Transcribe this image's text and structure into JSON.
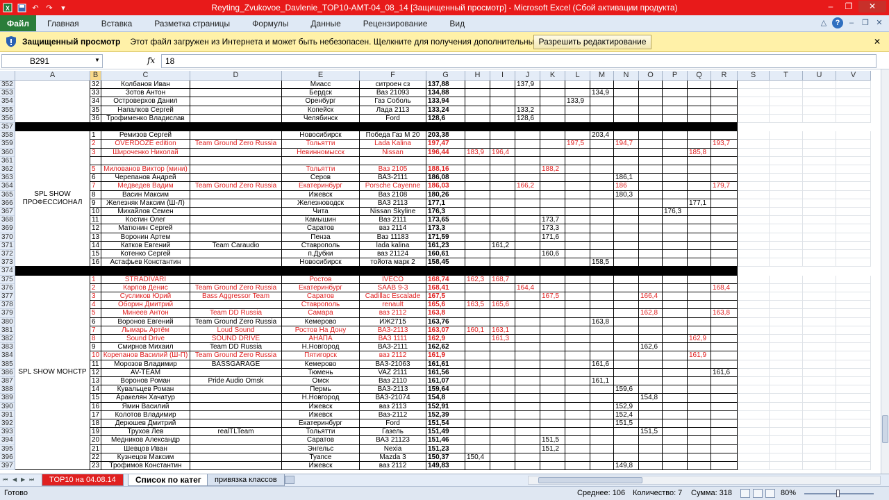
{
  "window": {
    "title": "Reyting_Zvukovoe_Davlenie_TOP10-AMT-04_08_14  [Защищенный просмотр]  -  Microsoft Excel (Сбой активации продукта)"
  },
  "ribbon": {
    "file_tab": "Файл",
    "tabs": [
      "Главная",
      "Вставка",
      "Разметка страницы",
      "Формулы",
      "Данные",
      "Рецензирование",
      "Вид"
    ]
  },
  "protected_view": {
    "title": "Защищенный просмотр",
    "message": "Этот файл загружен из Интернета и может быть небезопасен. Щелкните для получения дополнительных сведений.",
    "button": "Разрешить редактирование"
  },
  "formula_bar": {
    "name_box": "B291",
    "fx": "fx",
    "value": "18"
  },
  "columns": [
    "A",
    "B",
    "C",
    "D",
    "E",
    "F",
    "G",
    "H",
    "I",
    "J",
    "K",
    "L",
    "M",
    "N",
    "O",
    "P",
    "Q",
    "R",
    "S",
    "T",
    "U",
    "V"
  ],
  "sheet": {
    "group_labels": {
      "top": "",
      "professional": "SPL SHOW ПРОФЕССИОНАЛ",
      "monster": "SPL SHOW МОНСТР"
    },
    "rows": [
      {
        "n": "352",
        "b": "32",
        "c": "Колбанов Иван",
        "d": "",
        "e": "Миасс",
        "f": "ситроен сз",
        "g": "137,88",
        "vals": {
          "J": "137,9"
        }
      },
      {
        "n": "353",
        "b": "33",
        "c": "Зотов Антон",
        "d": "",
        "e": "Бердск",
        "f": "Ваз 21093",
        "g": "134,88",
        "vals": {
          "M": "134,9"
        }
      },
      {
        "n": "354",
        "b": "34",
        "c": "Островерхов Данил",
        "d": "",
        "e": "Оренбург",
        "f": "Газ Соболь",
        "g": "133,94",
        "vals": {
          "L": "133,9"
        }
      },
      {
        "n": "355",
        "b": "35",
        "c": "Напалков Сергей",
        "d": "",
        "e": "Копейск",
        "f": "Лада 2113",
        "g": "133,24",
        "vals": {
          "J": "133,2"
        }
      },
      {
        "n": "356",
        "b": "36",
        "c": "Трофименко Владислав",
        "d": "",
        "e": "Челябинск",
        "f": "Ford",
        "g": "128,6",
        "vals": {
          "J": "128,6"
        }
      },
      {
        "n": "357",
        "black": true
      },
      {
        "n": "358",
        "b": "1",
        "c": "Ремизов Сергей",
        "d": "",
        "e": "Новосибирск",
        "f": "Победа Газ М 20",
        "g": "203,38",
        "vals": {
          "M": "203,4"
        }
      },
      {
        "n": "359",
        "b": "2",
        "c": "OVERDOZE edition",
        "d": "Team Ground Zero Russia",
        "e": "Тольятти",
        "f": "Lada Kalina",
        "g": "197,47",
        "red": true,
        "vals": {
          "L": "197,5",
          "N": "194,7",
          "R": "193,7"
        }
      },
      {
        "n": "360",
        "b": "3",
        "c": "Широченко Николай",
        "d": "",
        "e": "Невинномысск",
        "f": "Nissan",
        "g": "196,44",
        "red": true,
        "vals": {
          "H": "183,9",
          "I": "196,4",
          "Q": "185,8"
        }
      },
      {
        "n": "361",
        "b": "",
        "c": "",
        "d": "",
        "e": "",
        "f": "",
        "g": "",
        "vals": {}
      },
      {
        "n": "362",
        "b": "5",
        "c": "Милованов Виктор (мини)",
        "d": "",
        "e": "Тольятти",
        "f": "Ваз 2105",
        "g": "188,16",
        "red": true,
        "vals": {
          "K": "188,2"
        }
      },
      {
        "n": "363",
        "b": "6",
        "c": "Черепанов Андрей",
        "d": "",
        "e": "Серов",
        "f": "ВАЗ-2111",
        "g": "186,08",
        "vals": {
          "N": "186,1"
        }
      },
      {
        "n": "364",
        "b": "7",
        "c": "Медведев Вадим",
        "d": "Team Ground Zero Russia",
        "e": "Екатеринбург",
        "f": "Porsche Cayenne",
        "g": "186,03",
        "red": true,
        "vals": {
          "J": "166,2",
          "N": "186",
          "R": "179,7"
        }
      },
      {
        "n": "365",
        "b": "8",
        "c": "Васин Максим",
        "d": "",
        "e": "Ижевск",
        "f": "Ваз 2108",
        "g": "180,26",
        "vals": {
          "N": "180,3"
        }
      },
      {
        "n": "366",
        "b": "9",
        "c": "Железняк Максим (Ш-Л)",
        "d": "",
        "e": "Железноводск",
        "f": "ВАЗ 2113",
        "g": "177,1",
        "vals": {
          "Q": "177,1"
        }
      },
      {
        "n": "367",
        "b": "10",
        "c": "Михайлов Семен",
        "d": "",
        "e": "Чита",
        "f": "Nissan Skyline",
        "g": "176,3",
        "vals": {
          "P": "176,3"
        }
      },
      {
        "n": "368",
        "b": "11",
        "c": "Костин Олег",
        "d": "",
        "e": "Камышин",
        "f": "Ваз 2111",
        "g": "173,65",
        "vals": {
          "K": "173,7"
        }
      },
      {
        "n": "369",
        "b": "12",
        "c": "Матюнин Сергей",
        "d": "",
        "e": "Саратов",
        "f": "ваз 2114",
        "g": "173,3",
        "vals": {
          "K": "173,3"
        }
      },
      {
        "n": "370",
        "b": "13",
        "c": "Воронин Артем",
        "d": "",
        "e": "Пенза",
        "f": "Ваз 11183",
        "g": "171,59",
        "vals": {
          "K": "171,6"
        }
      },
      {
        "n": "371",
        "b": "14",
        "c": "Катков Евгений",
        "d": "Team Caraudio",
        "e": "Ставрополь",
        "f": "lada kalina",
        "g": "161,23",
        "vals": {
          "I": "161,2"
        }
      },
      {
        "n": "372",
        "b": "15",
        "c": "Котенко Сергей",
        "d": "",
        "e": "п.Дубки",
        "f": "ваз 21124",
        "g": "160,61",
        "vals": {
          "K": "160,6"
        }
      },
      {
        "n": "373",
        "b": "16",
        "c": "Астафьев Константин",
        "d": "",
        "e": "Новосибирск",
        "f": "тойота марк 2",
        "g": "158,45",
        "vals": {
          "M": "158,5"
        }
      },
      {
        "n": "374",
        "black": true
      },
      {
        "n": "375",
        "b": "1",
        "c": "STRADIVARI",
        "d": "",
        "e": "Ростов",
        "f": "IVECO",
        "g": "168,74",
        "red": true,
        "vals": {
          "H": "162,3",
          "I": "168,7"
        }
      },
      {
        "n": "376",
        "b": "2",
        "c": "Карпов Денис",
        "d": "Team Ground Zero Russia",
        "e": "Екатеринбург",
        "f": "SAAB 9-3",
        "g": "168,41",
        "red": true,
        "vals": {
          "J": "164,4",
          "R": "168,4"
        }
      },
      {
        "n": "377",
        "b": "3",
        "c": "Сусликов Юрий",
        "d": "Bass Aggressor Team",
        "e": "Саратов",
        "f": "Cadillac Escalade",
        "g": "167,5",
        "red": true,
        "vals": {
          "K": "167,5",
          "O": "166,4"
        }
      },
      {
        "n": "378",
        "b": "4",
        "c": "Оборин Дмитрий",
        "d": "",
        "e": "Ставрополь",
        "f": "renault",
        "g": "165,6",
        "red": true,
        "vals": {
          "H": "163,5",
          "I": "165,6"
        }
      },
      {
        "n": "379",
        "b": "5",
        "c": "Минеев Антон",
        "d": "Team DD Russia",
        "e": "Самара",
        "f": "ваз 2112",
        "g": "163,8",
        "red": true,
        "vals": {
          "O": "162,8",
          "R": "163,8"
        }
      },
      {
        "n": "380",
        "b": "6",
        "c": "Воронов Евгений",
        "d": "Team Ground Zero Russia",
        "e": "Кемерово",
        "f": "ИЖ2715",
        "g": "163,76",
        "vals": {
          "M": "163,8"
        }
      },
      {
        "n": "381",
        "b": "7",
        "c": "Лымарь Артём",
        "d": "Loud Sound",
        "e": "Ростов На Дону",
        "f": "ВАЗ-2113",
        "g": "163,07",
        "red": true,
        "vals": {
          "H": "160,1",
          "I": "163,1"
        }
      },
      {
        "n": "382",
        "b": "8",
        "c": "Sound Drive",
        "d": "SOUND DRIVE",
        "e": "АНАПА",
        "f": "ВАЗ 1111",
        "g": "162,9",
        "red": true,
        "vals": {
          "I": "161,3",
          "Q": "162,9"
        }
      },
      {
        "n": "383",
        "b": "9",
        "c": "Смирнов Михаил",
        "d": "Team DD Russia",
        "e": "Н.Новгород",
        "f": "ВАЗ-2111",
        "g": "162,62",
        "vals": {
          "O": "162,6"
        }
      },
      {
        "n": "384",
        "b": "10",
        "c": "Корепанов Василий (Ш-П)",
        "d": "Team Ground Zero Russia",
        "e": "Пятигорск",
        "f": "ваз 2112",
        "g": "161,9",
        "red": true,
        "vals": {
          "Q": "161,9"
        }
      },
      {
        "n": "385",
        "b": "11",
        "c": "Морозов Владимир",
        "d": "BASSGARAGE",
        "e": "Кемерово",
        "f": "ВАЗ-21063",
        "g": "161,61",
        "vals": {
          "M": "161,6"
        }
      },
      {
        "n": "386",
        "b": "12",
        "c": "AV-TEAM",
        "d": "",
        "e": "Тюмень",
        "f": "VAZ 2111",
        "g": "161,56",
        "vals": {
          "R": "161,6"
        }
      },
      {
        "n": "387",
        "b": "13",
        "c": "Воронов Роман",
        "d": "Pride Audio Omsk",
        "e": "Омск",
        "f": "Ваз 2110",
        "g": "161,07",
        "vals": {
          "M": "161,1"
        }
      },
      {
        "n": "388",
        "b": "14",
        "c": "Кувальцев Роман",
        "d": "",
        "e": "Пермь",
        "f": "ВАЗ-2113",
        "g": "159,64",
        "vals": {
          "N": "159,6"
        }
      },
      {
        "n": "389",
        "b": "15",
        "c": "Аракелян Хачатур",
        "d": "",
        "e": "Н.Новгород",
        "f": "ВАЗ-21074",
        "g": "154,8",
        "vals": {
          "O": "154,8"
        }
      },
      {
        "n": "390",
        "b": "16",
        "c": "Ямин Василий",
        "d": "",
        "e": "Ижевск",
        "f": "ваз 2113",
        "g": "152,91",
        "vals": {
          "N": "152,9"
        }
      },
      {
        "n": "391",
        "b": "17",
        "c": "Колотов Владимир",
        "d": "",
        "e": "Ижевск",
        "f": "Ваз-2112",
        "g": "152,39",
        "vals": {
          "N": "152,4"
        }
      },
      {
        "n": "392",
        "b": "18",
        "c": "Дерюшев Дмитрий",
        "d": "",
        "e": "Екатеринбург",
        "f": "Ford",
        "g": "151,54",
        "vals": {
          "N": "151,5"
        }
      },
      {
        "n": "393",
        "b": "19",
        "c": "Трухов Лев",
        "d": "realTLTeam",
        "e": "Тольятти",
        "f": "Газель",
        "g": "151,49",
        "vals": {
          "O": "151,5"
        }
      },
      {
        "n": "394",
        "b": "20",
        "c": "Медников Александр",
        "d": "",
        "e": "Саратов",
        "f": "ВАЗ 21123",
        "g": "151,46",
        "vals": {
          "K": "151,5"
        }
      },
      {
        "n": "395",
        "b": "21",
        "c": "Шевцов Иван",
        "d": "",
        "e": "Энгельс",
        "f": "Nexia",
        "g": "151,23",
        "vals": {
          "K": "151,2"
        }
      },
      {
        "n": "396",
        "b": "22",
        "c": "Кузнецов Максим",
        "d": "",
        "e": "Туапсе",
        "f": "Mazda 3",
        "g": "150,37",
        "vals": {
          "H": "150,4"
        }
      },
      {
        "n": "397",
        "b": "23",
        "c": "Трофимов Константин",
        "d": "",
        "e": "Ижевск",
        "f": "ваз 2112",
        "g": "149,83",
        "vals": {
          "N": "149,8"
        }
      }
    ]
  },
  "sheet_tabs": [
    "TOP10 на 04.08.14",
    "Список по катег",
    "привязка классов"
  ],
  "status": {
    "ready": "Готово",
    "average": "Среднее: 106",
    "count": "Количество: 7",
    "sum": "Сумма: 318",
    "zoom": "80%"
  },
  "colors": {
    "titlebar": "#e81a1a",
    "file_tab": "#2a7d3a",
    "protected_bar": "#fff1a8",
    "red_text": "#e02020"
  }
}
